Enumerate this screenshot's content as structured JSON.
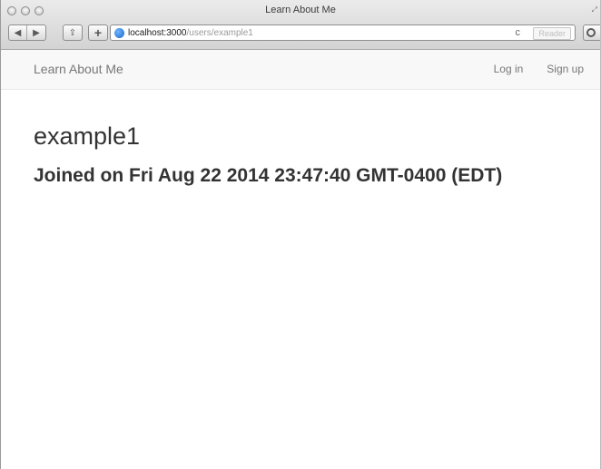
{
  "window": {
    "title": "Learn About Me"
  },
  "toolbar": {
    "back_glyph": "◀",
    "forward_glyph": "▶",
    "share_glyph": "⇪",
    "new_tab_glyph": "+",
    "reload_glyph": "c",
    "reader_label": "Reader"
  },
  "address_bar": {
    "host": "localhost:3000",
    "path": "/users/example1"
  },
  "navbar": {
    "brand": "Learn About Me",
    "login": "Log in",
    "signup": "Sign up"
  },
  "profile": {
    "username": "example1",
    "joined": "Joined on Fri Aug 22 2014 23:47:40 GMT-0400 (EDT)"
  }
}
